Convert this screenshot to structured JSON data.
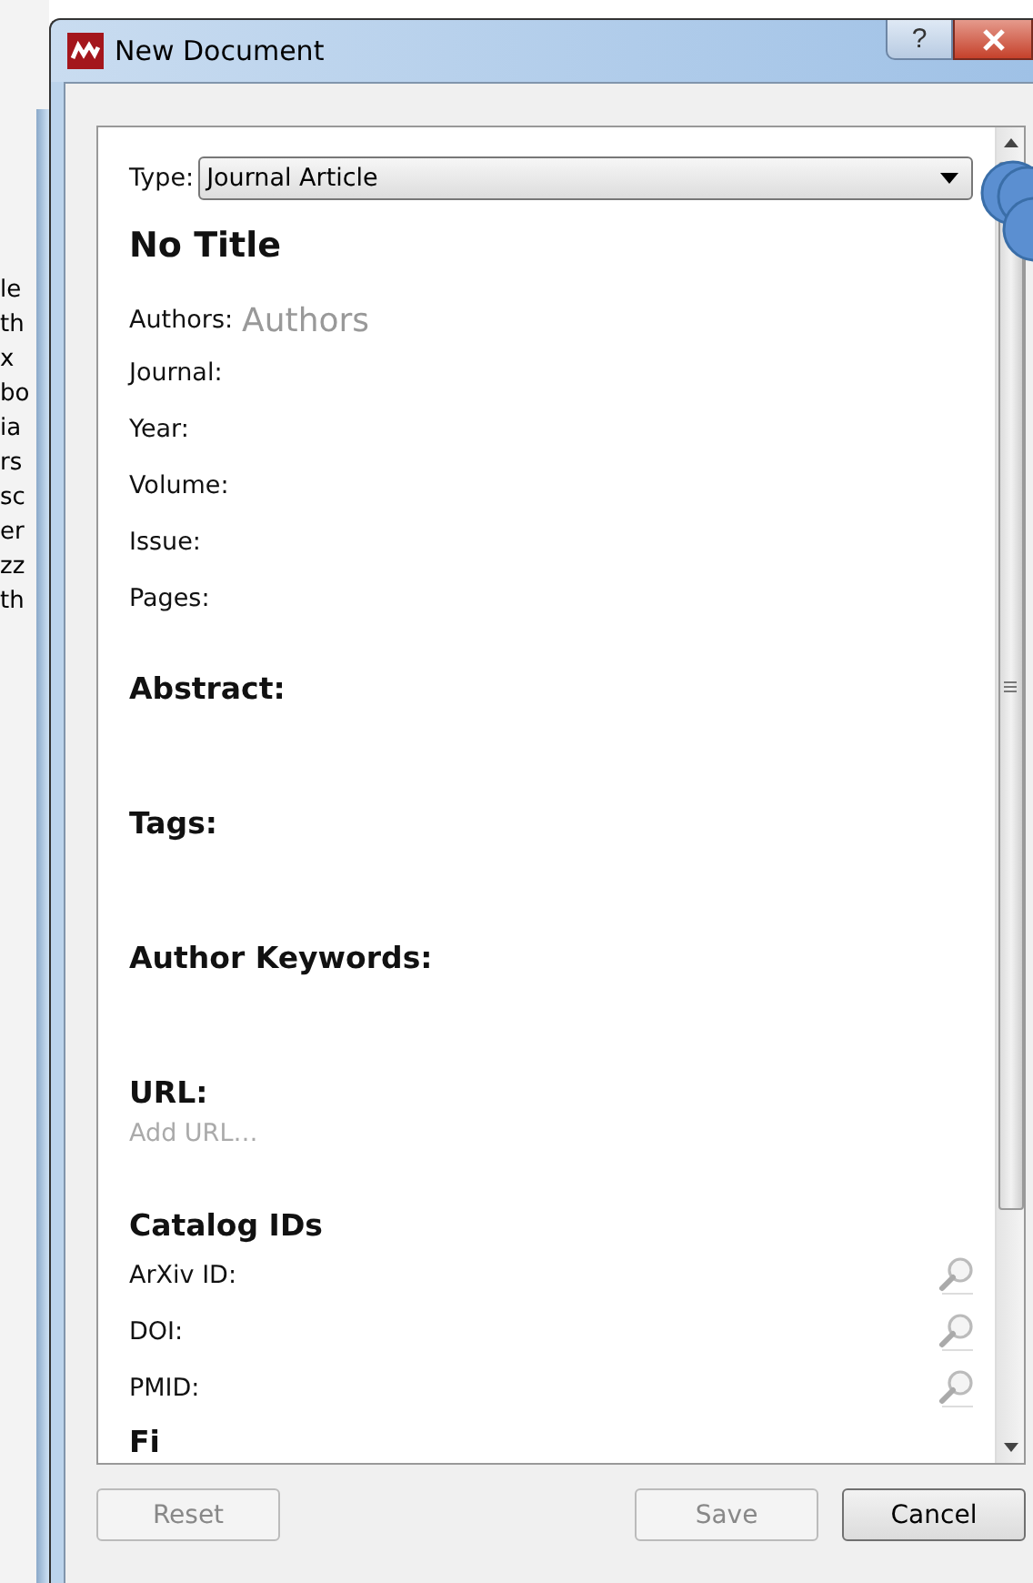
{
  "background_window": {
    "text_fragments": [
      "le",
      "th",
      "x",
      "bo",
      "ia",
      "rs",
      "sc",
      "er",
      "zz",
      "th"
    ]
  },
  "window": {
    "title": "New Document",
    "help_label": "?"
  },
  "form": {
    "type_label": "Type:",
    "type_value": "Journal Article",
    "title": "No Title",
    "authors_label": "Authors:",
    "authors_placeholder": "Authors",
    "fields": [
      "Journal:",
      "Year:",
      "Volume:",
      "Issue:",
      "Pages:"
    ],
    "sections": [
      {
        "kind": "empty",
        "heading": "Abstract:"
      },
      {
        "kind": "empty",
        "heading": "Tags:"
      },
      {
        "kind": "empty",
        "heading": "Author Keywords:"
      },
      {
        "kind": "link",
        "heading": "URL:",
        "placeholder": "Add URL…"
      },
      {
        "kind": "ids",
        "heading": "Catalog IDs",
        "rows": [
          "ArXiv ID:",
          "DOI:",
          "PMID:"
        ]
      },
      {
        "kind": "empty",
        "heading": "Fi"
      }
    ]
  },
  "buttons": [
    {
      "label": "Reset",
      "disabled": true
    },
    {
      "label": "Save",
      "disabled": true
    },
    {
      "label": "Cancel",
      "disabled": false
    }
  ]
}
